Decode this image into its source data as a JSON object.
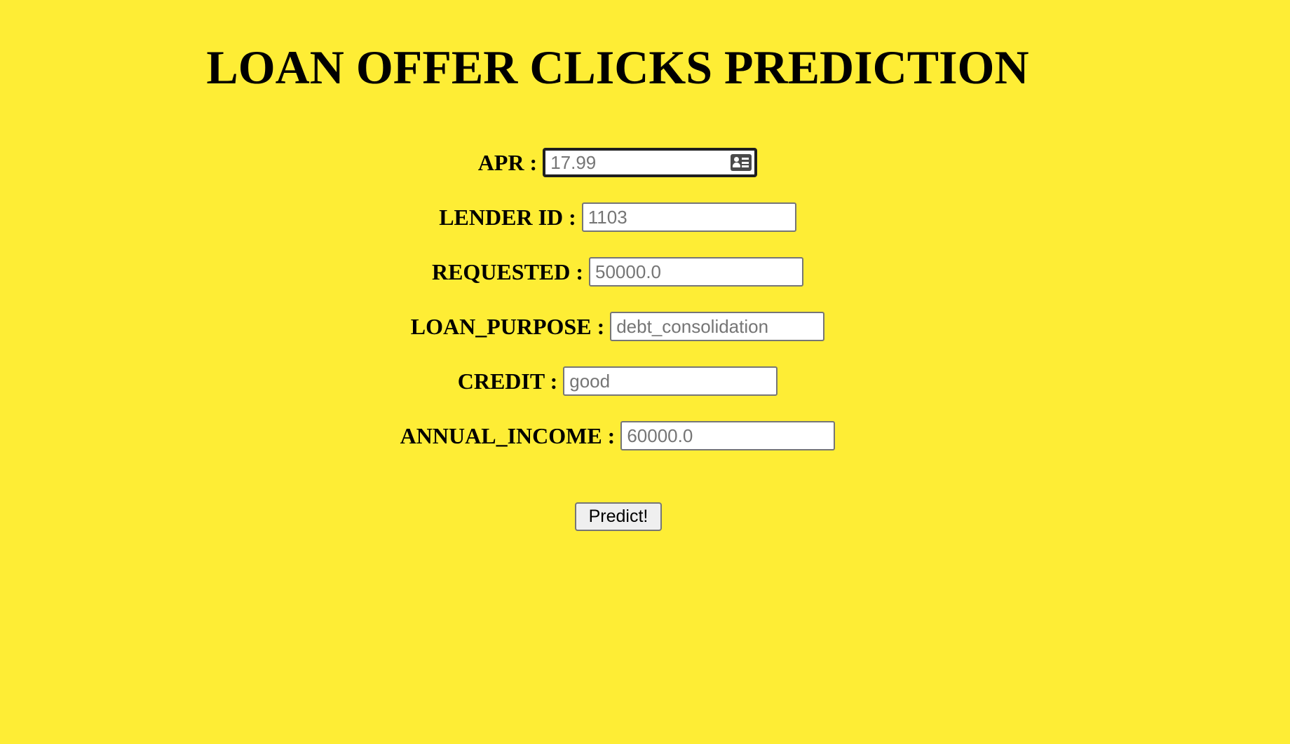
{
  "page": {
    "title": "LOAN OFFER CLICKS PREDICTION",
    "background_color": "#FEED35"
  },
  "form": {
    "fields": [
      {
        "label": "APR :",
        "placeholder": "17.99",
        "value": "",
        "focused": true,
        "autofill_icon": "contact-card-icon"
      },
      {
        "label": "LENDER ID :",
        "placeholder": "1103",
        "value": ""
      },
      {
        "label": "REQUESTED :",
        "placeholder": "50000.0",
        "value": ""
      },
      {
        "label": "LOAN_PURPOSE :",
        "placeholder": "debt_consolidation",
        "value": ""
      },
      {
        "label": "CREDIT :",
        "placeholder": "good",
        "value": ""
      },
      {
        "label": "ANNUAL_INCOME :",
        "placeholder": "60000.0",
        "value": ""
      }
    ],
    "submit_label": "Predict!"
  }
}
